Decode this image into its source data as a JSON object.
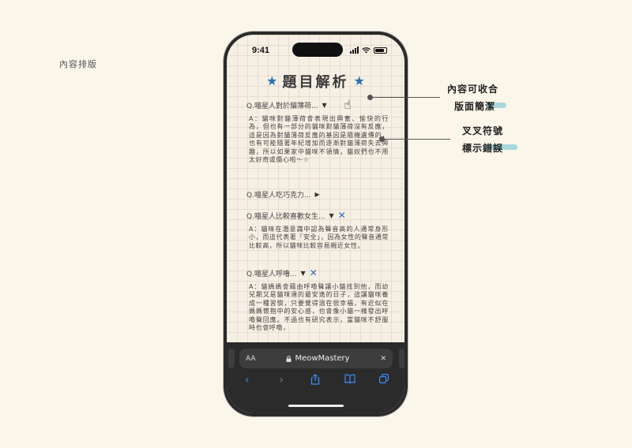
{
  "page_label": "內容排版",
  "status": {
    "time": "9:41"
  },
  "title": "題目解析",
  "questions": [
    {
      "q": "Q.喵星人對於貓薄荷...",
      "state": "expanded",
      "a": "A：貓咪對貓薄荷會表現出興奮、愉快的行為，但也有一部分的貓咪對貓薄荷沒有反應，這是因為對貓薄荷反應的基因是隨機遺傳的，也有可能隨著年紀增加而逐漸對貓薄荷失去興趣，所以如果家中貓咪不領情，貓奴們也不用太好奇或傷心啦～☆"
    },
    {
      "q": "Q.喵星人吃巧克力...",
      "state": "collapsed",
      "a": ""
    },
    {
      "q": "Q.喵星人比較喜歡女生...",
      "state": "wrong",
      "a": "A：貓咪在潛意識中認為聲音高的人通常身形小，而這代表著「安全」，因為女性的聲音通常比較高，所以貓咪比較容易親近女性。"
    },
    {
      "q": "Q.喵星人呼嚕...",
      "state": "wrong",
      "a": "A：貓媽媽會藉由呼嚕聲讓小貓找到他，而幼兒期又是貓咪達的最安逸的日子，這讓貓咪養成一種習慣，只要覺得溫在很幸福，有近似在媽媽懷抱中的安心感，也會像小貓一樣發出呼嚕聲回應。不過也有研究表示，當貓咪不舒服時也會呼嚕，"
    }
  ],
  "browser": {
    "text_size": "AA",
    "url": "MeowMastery",
    "close": "✕"
  },
  "annotations": [
    {
      "line1": "內容可收合",
      "line2": "版面簡潔"
    },
    {
      "line1": "叉叉符號",
      "line2": "標示錯誤"
    }
  ],
  "colors": {
    "accent": "#2c6fb7",
    "highlight": "#9fd4dd",
    "background": "#faf6ea"
  }
}
